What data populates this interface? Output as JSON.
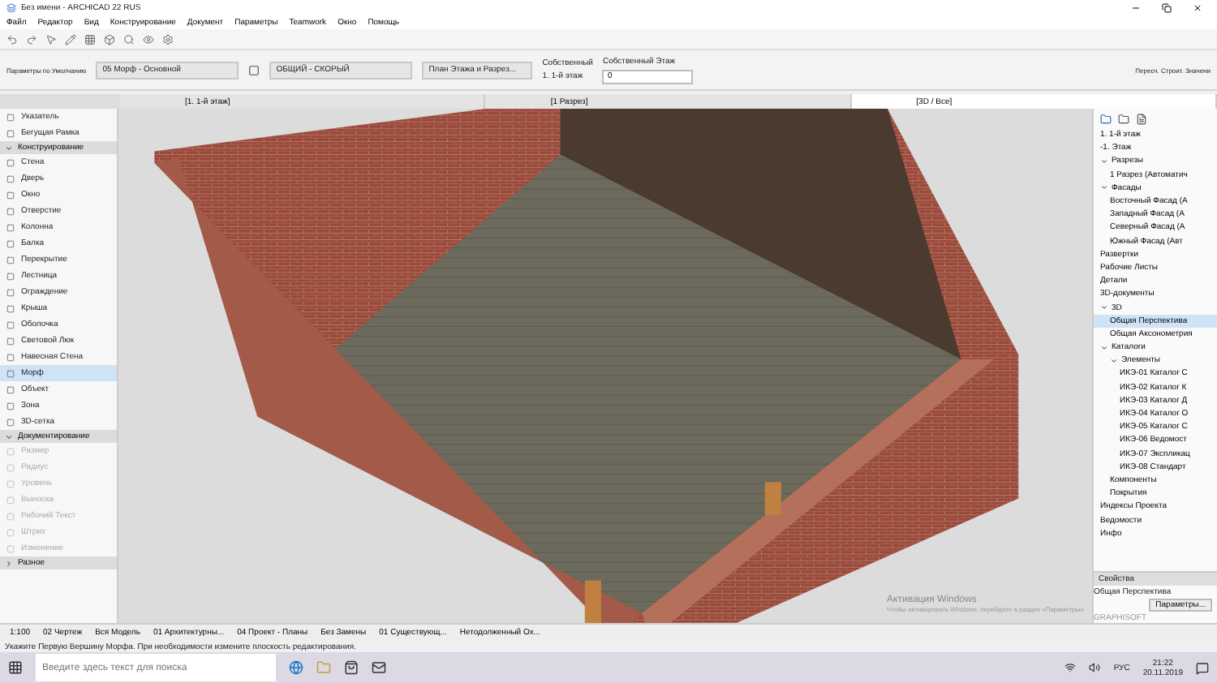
{
  "window": {
    "title": "Без имени - ARCHICAD 22 RUS"
  },
  "menu": [
    "Файл",
    "Редактор",
    "Вид",
    "Конструирование",
    "Документ",
    "Параметры",
    "Teamwork",
    "Окно",
    "Помощь"
  ],
  "info_box": {
    "label": "Параметры по Умолчанию",
    "element": "05 Морф - Основной",
    "model_view": "ОБЩИЙ - СКОРЫЙ",
    "display": "План Этажа и Разрез...",
    "story_label": "Собственный",
    "story_value": "1. 1-й этаж",
    "home_story": "Собственный Этаж",
    "home_value": "0",
    "side_text": "Пересч. Строит. Значени"
  },
  "view_tabs": [
    {
      "label": "[1. 1-й этаж]",
      "selected": false
    },
    {
      "label": "[1 Разрез]",
      "selected": false
    },
    {
      "label": "[3D / Все]",
      "selected": true
    }
  ],
  "toolbox": [
    {
      "label": "Указатель",
      "kind": "tool",
      "selected": false,
      "disabled": false
    },
    {
      "label": "Бегущая Рамка",
      "kind": "tool",
      "selected": false,
      "disabled": false
    },
    {
      "label": "Конструирование",
      "kind": "header",
      "expanded": true
    },
    {
      "label": "Стена",
      "kind": "tool",
      "selected": false,
      "disabled": false
    },
    {
      "label": "Дверь",
      "kind": "tool",
      "selected": false,
      "disabled": false
    },
    {
      "label": "Окно",
      "kind": "tool",
      "selected": false,
      "disabled": false
    },
    {
      "label": "Отверстие",
      "kind": "tool",
      "selected": false,
      "disabled": false
    },
    {
      "label": "Колонна",
      "kind": "tool",
      "selected": false,
      "disabled": false
    },
    {
      "label": "Балка",
      "kind": "tool",
      "selected": false,
      "disabled": false
    },
    {
      "label": "Перекрытие",
      "kind": "tool",
      "selected": false,
      "disabled": false
    },
    {
      "label": "Лестница",
      "kind": "tool",
      "selected": false,
      "disabled": false
    },
    {
      "label": "Ограждение",
      "kind": "tool",
      "selected": false,
      "disabled": false
    },
    {
      "label": "Крыша",
      "kind": "tool",
      "selected": false,
      "disabled": false
    },
    {
      "label": "Оболочка",
      "kind": "tool",
      "selected": false,
      "disabled": false
    },
    {
      "label": "Световой Люк",
      "kind": "tool",
      "selected": false,
      "disabled": false
    },
    {
      "label": "Навесная Стена",
      "kind": "tool",
      "selected": false,
      "disabled": false
    },
    {
      "label": "Морф",
      "kind": "tool",
      "selected": true,
      "disabled": false
    },
    {
      "label": "Объект",
      "kind": "tool",
      "selected": false,
      "disabled": false
    },
    {
      "label": "Зона",
      "kind": "tool",
      "selected": false,
      "disabled": false
    },
    {
      "label": "3D-сетка",
      "kind": "tool",
      "selected": false,
      "disabled": false
    },
    {
      "label": "Документирование",
      "kind": "header",
      "expanded": true
    },
    {
      "label": "Размер",
      "kind": "tool",
      "selected": false,
      "disabled": true
    },
    {
      "label": "Радиус",
      "kind": "tool",
      "selected": false,
      "disabled": true
    },
    {
      "label": "Уровень",
      "kind": "tool",
      "selected": false,
      "disabled": true
    },
    {
      "label": "Выноска",
      "kind": "tool",
      "selected": false,
      "disabled": true
    },
    {
      "label": "Рабочий Текст",
      "kind": "tool",
      "selected": false,
      "disabled": true
    },
    {
      "label": "Штрих",
      "kind": "tool",
      "selected": false,
      "disabled": true
    },
    {
      "label": "Изменение",
      "kind": "tool",
      "selected": false,
      "disabled": true
    },
    {
      "label": "Разное",
      "kind": "header",
      "expanded": false
    }
  ],
  "navigator": [
    {
      "label": "1. 1-й этаж",
      "selected": false
    },
    {
      "label": "-1. Этаж",
      "selected": false
    },
    {
      "label": "Разрезы",
      "expanded": true,
      "selected": false,
      "children": [
        {
          "label": "1 Разрез (Автоматич",
          "selected": false
        }
      ]
    },
    {
      "label": "Фасады",
      "expanded": true,
      "selected": false,
      "children": [
        {
          "label": "Восточный Фасад (А",
          "selected": false
        },
        {
          "label": "Западный Фасад (А",
          "selected": false
        },
        {
          "label": "Северный Фасад (А",
          "selected": false
        },
        {
          "label": "Южный Фасад (Авт",
          "selected": false
        }
      ]
    },
    {
      "label": "Развертки",
      "selected": false
    },
    {
      "label": "Рабочие Листы",
      "selected": false
    },
    {
      "label": "Детали",
      "selected": false
    },
    {
      "label": "3D-документы",
      "selected": false
    },
    {
      "label": "3D",
      "expanded": true,
      "selected": false,
      "children": [
        {
          "label": "Общая Перспектива",
          "selected": true
        },
        {
          "label": "Общая Аксонометрия",
          "selected": false
        }
      ]
    },
    {
      "label": "Каталоги",
      "expanded": true,
      "selected": false,
      "children": [
        {
          "label": "Элементы",
          "expanded": true,
          "selected": false,
          "children": [
            {
              "label": "ИКЭ-01 Каталог С",
              "selected": false
            },
            {
              "label": "ИКЭ-02 Каталог К",
              "selected": false
            },
            {
              "label": "ИКЭ-03 Каталог Д",
              "selected": false
            },
            {
              "label": "ИКЭ-04 Каталог О",
              "selected": false
            },
            {
              "label": "ИКЭ-05 Каталог С",
              "selected": false
            },
            {
              "label": "ИКЭ-06 Ведомост",
              "selected": false
            },
            {
              "label": "ИКЭ-07 Экспликац",
              "selected": false
            },
            {
              "label": "ИКЭ-08 Стандарт",
              "selected": false
            }
          ]
        },
        {
          "label": "Компоненты",
          "selected": false
        },
        {
          "label": "Покрытия",
          "selected": false
        }
      ]
    },
    {
      "label": "Индексы Проекта",
      "selected": false
    },
    {
      "label": "Ведомости",
      "selected": false
    },
    {
      "label": "Инфо",
      "selected": false
    }
  ],
  "properties": {
    "title": "Свойства",
    "view": "Общая Перспектива",
    "button": "Параметры..."
  },
  "activation": {
    "title": "Активация Windows",
    "text": "Чтобы активировать Windows, перейдите в раздел «Параметры»."
  },
  "bottom_bar": {
    "zoom": "1:100",
    "items": [
      "02 Чертеж",
      "Вся Модель",
      "01 Архитектурны...",
      "04 Проект - Планы",
      "Без Замены",
      "01 Существующ...",
      "Нетодолженный Ох..."
    ]
  },
  "brand": "GRAPHISOFT",
  "status_text": "Укажите Первую Вершину Морфа. При необходимости измените плоскость редактирования.",
  "taskbar": {
    "search_placeholder": "Введите здесь текст для поиска",
    "lang": "РУС",
    "time": "21:22",
    "date": "20.11.2019"
  }
}
